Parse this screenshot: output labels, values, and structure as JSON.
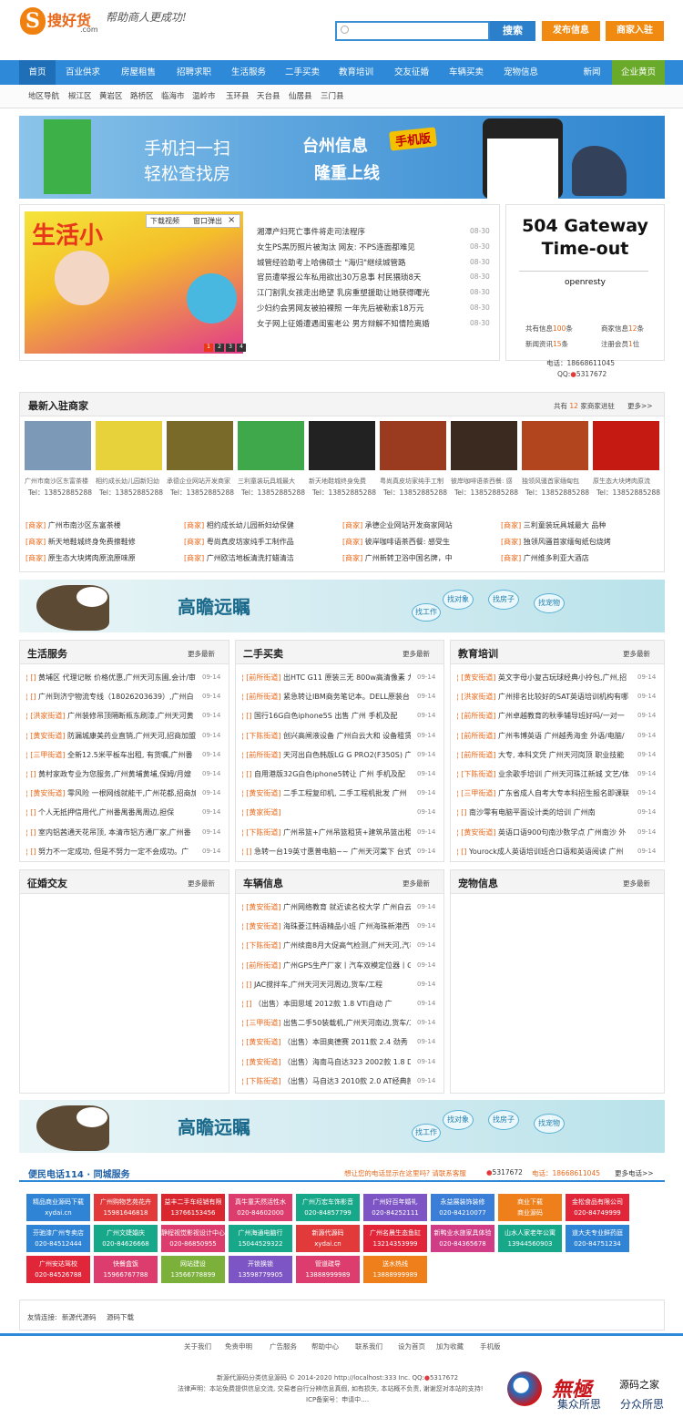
{
  "header": {
    "logo_mark": "S",
    "logo_text": "搜好货",
    "logo_domain": ".com",
    "slogan": "帮助商人更成功!",
    "search_button": "搜索",
    "publish_button": "发布信息",
    "join_button": "商家入驻",
    "search_placeholder": ""
  },
  "nav": {
    "items": [
      "首页",
      "百业供求",
      "房屋租售",
      "招聘求职",
      "生活服务",
      "二手买卖",
      "教育培训",
      "交友征婚",
      "车辆买卖",
      "宠物信息",
      "新闻",
      "企业黄页"
    ]
  },
  "subnav": {
    "items": [
      "地区导航",
      "椒江区",
      "黄岩区",
      "路桥区",
      "临海市",
      "温岭市",
      "玉环县",
      "天台县",
      "仙居县",
      "三门县"
    ]
  },
  "banner": {
    "line1": "手机扫一扫",
    "line2": "轻松查找房",
    "title1": "台州信息",
    "title2": "隆重上线",
    "badge": "手机版"
  },
  "slide": {
    "tab_download": "下载视频",
    "tab_popup": "窗口弹出",
    "close": "×",
    "big_text": "生活小",
    "dots": [
      "1",
      "2",
      "3",
      "4"
    ]
  },
  "news": [
    {
      "title": "湘潭产妇死亡事件将走司法程序",
      "date": "08-30"
    },
    {
      "title": "女生PS黑历照片被淘汰 网友: 不PS连面都难见",
      "date": "08-30"
    },
    {
      "title": "城管经验助考上哈佛硕士 \"海归\"继续城管路",
      "date": "08-30"
    },
    {
      "title": "官员遭举报公车私用欲出30万息事 村民猥琐8天",
      "date": "08-30"
    },
    {
      "title": "江门割乳女孩走出绝望 乳房重塑援助让她获得曙光",
      "date": "08-30"
    },
    {
      "title": "少妇约会男网友被拍裸照 一年先后被勒索18万元",
      "date": "08-30"
    },
    {
      "title": "女子网上征婚遭遇闺蜜老公 男方辩解不知情险离婚",
      "date": "08-30"
    }
  ],
  "error_box": {
    "title": "504 Gateway Time-out",
    "server": "openresty"
  },
  "stats": {
    "info_label": "共有信息",
    "info_count": "100",
    "info_unit": "条",
    "merchant_label": "商家信息",
    "merchant_count": "12",
    "merchant_unit": "条",
    "news_label": "新闻资讯",
    "news_count": "15",
    "news_unit": "条",
    "member_label": "注册会员",
    "member_count": "1",
    "member_unit": "位",
    "phone_label": "电话：",
    "phone": "18668611045",
    "qq_label": "QQ:",
    "qq": "5317672"
  },
  "merchants": {
    "title": "最新入驻商家",
    "count_prefix": "共有",
    "count": "12",
    "count_suffix": "家商家进驻",
    "more": "更多>>",
    "items": [
      {
        "name": "广州市南沙区东富茶楼",
        "tel": "Tel：13852885288",
        "color": "#7d99b8"
      },
      {
        "name": "相约成长幼儿园新妇幼",
        "tel": "Tel：13852885288",
        "color": "#e8d23c"
      },
      {
        "name": "承德企业网站开发商家",
        "tel": "Tel：13852885288",
        "color": "#7a6a2a"
      },
      {
        "name": "三利童装玩具城最大",
        "tel": "Tel：13852885288",
        "color": "#3fa84a"
      },
      {
        "name": "新天地鞋城终身免费",
        "tel": "Tel：13852885288",
        "color": "#222222"
      },
      {
        "name": "粤尚真皮坊家纯手工制",
        "tel": "Tel：13852885288",
        "color": "#9a3a1e"
      },
      {
        "name": "彼岸咖啡语茶西餐: 感",
        "tel": "Tel：13852885288",
        "color": "#3b2a20"
      },
      {
        "name": "独领风骚首家缅甸包",
        "tel": "Tel：13852885288",
        "color": "#b2451e"
      },
      {
        "name": "原生态大块烤肉原流",
        "tel": "Tel：13852885288",
        "color": "#c41a12"
      }
    ],
    "links": [
      {
        "tag": "[商家]",
        "text": "广州市南沙区东富茶楼"
      },
      {
        "tag": "[商家]",
        "text": "相约成长幼儿园新妇幼保健"
      },
      {
        "tag": "[商家]",
        "text": "承德企业网站开发商家网站"
      },
      {
        "tag": "[商家]",
        "text": "三利童装玩具城最大 品种"
      },
      {
        "tag": "[商家]",
        "text": "新天地鞋城终身免费擦鞋修"
      },
      {
        "tag": "[商家]",
        "text": "粤尚真皮坊家纯手工制作品"
      },
      {
        "tag": "[商家]",
        "text": "彼岸咖啡语茶西餐: 感受生"
      },
      {
        "tag": "[商家]",
        "text": "独领风骚首家缅甸纸包烧烤"
      },
      {
        "tag": "[商家]",
        "text": "原生态大块烤肉原流原味原"
      },
      {
        "tag": "[商家]",
        "text": "广州欧洁地板清洗打蜡清洁"
      },
      {
        "tag": "[商家]",
        "text": "广州新转卫浴中国名牌，中"
      },
      {
        "tag": "[商家]",
        "text": "广州维多利亚大酒店"
      }
    ]
  },
  "ad_banner": {
    "title": "高瞻远瞩",
    "bubbles": [
      "找对象",
      "找房子",
      "找工作",
      "找宠物"
    ]
  },
  "sections": {
    "life": {
      "title": "生活服务",
      "more": "更多最新",
      "items": [
        {
          "tag": "[]",
          "text": "黄埔区 代理记帐 价格优惠,广州天河东圃,会计/审",
          "date": "09-14"
        },
        {
          "tag": "[]",
          "text": "广州到济宁物流专线（18026203639）,广州白",
          "date": "09-14"
        },
        {
          "tag": "[洪家街道]",
          "text": "广州装修吊顶隔断瓶东刷漆,广州天河黄",
          "date": "09-14"
        },
        {
          "tag": "[黄安街道]",
          "text": "防漏城康美药业直销,广州天河,招商加盟",
          "date": "09-14"
        },
        {
          "tag": "[三甲街道]",
          "text": "全新12.5米平板车出租, 有货嘱,广州番",
          "date": "09-14"
        },
        {
          "tag": "[]",
          "text": "黄村家政专业为您服务,广州黄埔黄埔,保姆/月嫂",
          "date": "09-14"
        },
        {
          "tag": "[黄安街道]",
          "text": "零风险 一根网线就能干,广州花都,招商加",
          "date": "09-14"
        },
        {
          "tag": "[]",
          "text": "个人无抵押信用代,广州番禺番禺周边,担保",
          "date": "09-14"
        },
        {
          "tag": "[]",
          "text": "室内铝茜通天花吊顶, 本清市铝方通厂家,广州番",
          "date": "09-14"
        },
        {
          "tag": "[]",
          "text": "努力不一定成功, 但是不努力一定不会成功。广",
          "date": "09-14"
        }
      ]
    },
    "used": {
      "title": "二手买卖",
      "more": "更多最新",
      "items": [
        {
          "tag": "[前所街道]",
          "text": "出HTC G11 原装三无 800w高清像素 九",
          "date": "09-14"
        },
        {
          "tag": "[前所街道]",
          "text": "紧急转让IBM商务笔记本。DELL原装台",
          "date": "09-14"
        },
        {
          "tag": "[]",
          "text": "国行16G白色iphone5S 出售 广州 手机及配",
          "date": "09-14"
        },
        {
          "tag": "[下陈街道]",
          "text": "创兴高闸液设备 广州白云大和 设备租赁",
          "date": "09-14"
        },
        {
          "tag": "[前所街道]",
          "text": "天河出白色韩版LG G PRO2(F350S) 广",
          "date": "09-14"
        },
        {
          "tag": "[]",
          "text": "自用港版32G白色iphone5转让 广州 手机及配",
          "date": "09-14"
        },
        {
          "tag": "[黄安街道]",
          "text": "二手工程复印机, 二手工程机批发 广州",
          "date": "09-14"
        },
        {
          "tag": "[黄家街道]",
          "text": "",
          "date": "09-14"
        },
        {
          "tag": "[下陈街道]",
          "text": "广州吊篮+广州吊篮租赁+建筑吊篮出租",
          "date": "09-14"
        },
        {
          "tag": "[]",
          "text": "急转一台19英寸惠普电脑~~ 广州天河棠下 台式",
          "date": "09-14"
        }
      ]
    },
    "edu": {
      "title": "教育培训",
      "more": "更多最新",
      "items": [
        {
          "tag": "[黄安街道]",
          "text": "英文字母小复古玩球经典小拎包,广州,招",
          "date": "09-14"
        },
        {
          "tag": "[洪家街道]",
          "text": "广州排名比较好的SAT英语培训机构有哪",
          "date": "09-14"
        },
        {
          "tag": "[前所街道]",
          "text": "广州卓越教育的秋季辅导班好吗/一对一",
          "date": "09-14"
        },
        {
          "tag": "[前所街道]",
          "text": "广州韦博英语 广州越秀海金 外语/电脑/",
          "date": "09-14"
        },
        {
          "tag": "[前所街道]",
          "text": "大专, 本科文凭 广州天河岗顶 职业技能",
          "date": "09-14"
        },
        {
          "tag": "[下陈街道]",
          "text": "业余歌手培训 广州天河珠江新城 文艺/体",
          "date": "09-14"
        },
        {
          "tag": "[三甲街道]",
          "text": "广东省成人自考大专本科招生报名即课联",
          "date": "09-14"
        },
        {
          "tag": "[]",
          "text": "南沙零有电脑平面设计类的培训 广州南",
          "date": "09-14"
        },
        {
          "tag": "[黄安街道]",
          "text": "英语口语900句南沙数学点 广州南沙 外",
          "date": "09-14"
        },
        {
          "tag": "[]",
          "text": "Yourock成人英语培训班合口语和英语阅读 广州",
          "date": "09-14"
        }
      ]
    },
    "dating": {
      "title": "征婚交友",
      "more": "更多最新",
      "items": []
    },
    "cars": {
      "title": "车辆信息",
      "more": "更多最新",
      "items": [
        {
          "tag": "[黄安街道]",
          "text": "广州网络教育 就近读名校大学 广州白云",
          "date": "09-14"
        },
        {
          "tag": "[黄安街道]",
          "text": "海珠菱江韩语精品小班 广州海珠新港西",
          "date": "09-14"
        },
        {
          "tag": "[下陈街道]",
          "text": "广州续南8月大促高气检测,广州天河,汽车",
          "date": "09-14"
        },
        {
          "tag": "[前所街道]",
          "text": "广州GPS生产厂家丨汽车双模定位器丨G",
          "date": "09-14"
        },
        {
          "tag": "[]",
          "text": "JAC搅拌车,广州天河天河周边,货车/工程",
          "date": "09-14"
        },
        {
          "tag": "[]",
          "text": "（出售）本田思域 2012款 1.8 VTi自动 广",
          "date": "09-14"
        },
        {
          "tag": "[三甲街道]",
          "text": "出售二手50装载机,广州天河南边,货车/工",
          "date": "09-14"
        },
        {
          "tag": "[黄安街道]",
          "text": "（出售）本田奥德赛 2011款 2.4 劲秀",
          "date": "09-14"
        },
        {
          "tag": "[黄安街道]",
          "text": "（出售）海南马自达323 2002款 1.8 D",
          "date": "09-14"
        },
        {
          "tag": "[下陈街道]",
          "text": "（出售）马自达3 2010款 2.0 AT经典款",
          "date": "09-14"
        }
      ]
    },
    "pets": {
      "title": "宠物信息",
      "more": "更多最新",
      "items": []
    }
  },
  "services": {
    "title": "便民电话114 · 同城服务",
    "promo": "想让您的电话显示在这里吗? 请联系客服",
    "qq": "5317672",
    "phone_label": "电话：",
    "phone": "18668611045",
    "more": "更多电话>>",
    "items": [
      {
        "name": "精品商业源码下载",
        "tel": "xydai.cn",
        "color": "#2f84d6"
      },
      {
        "name": "广州购物艺苑花卉",
        "tel": "15981646818",
        "color": "#e23a3a"
      },
      {
        "name": "益丰二手车经销有限",
        "tel": "13766153456",
        "color": "#d9262f"
      },
      {
        "name": "真牛童天然活性水",
        "tel": "020-84602000",
        "color": "#dd3d6e"
      },
      {
        "name": "广州万宏车饰影音",
        "tel": "020-84857799",
        "color": "#17a88a"
      },
      {
        "name": "广州好百年婚礼",
        "tel": "020-84252111",
        "color": "#7d55c4"
      },
      {
        "name": "永益展装饰装修",
        "tel": "020-84210077",
        "color": "#3a7ed8"
      },
      {
        "name": "商业下载",
        "tel": "商业源码",
        "color": "#ef7f1a"
      },
      {
        "name": "金松食品有限公司",
        "tel": "020-84749999",
        "color": "#e2263a"
      },
      {
        "name": "芬驰漆广州专卖店",
        "tel": "020-84512444",
        "color": "#2f84d6"
      },
      {
        "name": "广州文婕婚庆",
        "tel": "020-84626668",
        "color": "#17a88a"
      },
      {
        "name": "静程视觉影视设计中心",
        "tel": "020-86850955",
        "color": "#dd3d6e"
      },
      {
        "name": "广州海通电脑行",
        "tel": "15044529322",
        "color": "#17a88a"
      },
      {
        "name": "新源代源码",
        "tel": "xydai.cn",
        "color": "#e23a3a"
      },
      {
        "name": "广州名晨生态鱼缸",
        "tel": "13214353999",
        "color": "#e2263a"
      },
      {
        "name": "新鸭业水旅家具体验",
        "tel": "020-84365678",
        "color": "#d13c86"
      },
      {
        "name": "山水人家老年公寓",
        "tel": "13944560903",
        "color": "#17a88a"
      },
      {
        "name": "道大夫专业鲜药庭",
        "tel": "020-84751234",
        "color": "#2f84d6"
      },
      {
        "name": "广州安达驾校",
        "tel": "020-84526788",
        "color": "#e2263a"
      },
      {
        "name": "快餐盒饭",
        "tel": "15966767788",
        "color": "#dd3d6e"
      },
      {
        "name": "网站建设",
        "tel": "13566778899",
        "color": "#7bb13a"
      },
      {
        "name": "开锁换锁",
        "tel": "13598779905",
        "color": "#7d55c4"
      },
      {
        "name": "管道疏导",
        "tel": "13888999989",
        "color": "#dd3d6e"
      },
      {
        "name": "送水热线",
        "tel": "13888999989",
        "color": "#ef7f1a"
      }
    ]
  },
  "friend_links": {
    "label": "友情连接:",
    "items": [
      "新源代源码",
      "源码下载"
    ]
  },
  "footer": {
    "links": [
      "关于我们",
      "免责申明",
      "广告服务",
      "帮助中心",
      "联系我们",
      "设为首页",
      "加为收藏",
      "手机版"
    ],
    "copyright": "新源代源码分类信息源码 © 2014-2020 http://localhost:333 Inc. QQ:",
    "copyright_qq": "5317672",
    "legal": "法律声明：本站免费提供信息交流, 交易者自行分辨信息真假, 如有损失, 本站概不负责, 谢谢您对本站的支持!",
    "icp": "ICP备案号：申请中....",
    "watermark": {
      "brand": "無極",
      "name": "源码之家",
      "slogan1": "集众所思",
      "slogan2": "分众所思"
    }
  }
}
